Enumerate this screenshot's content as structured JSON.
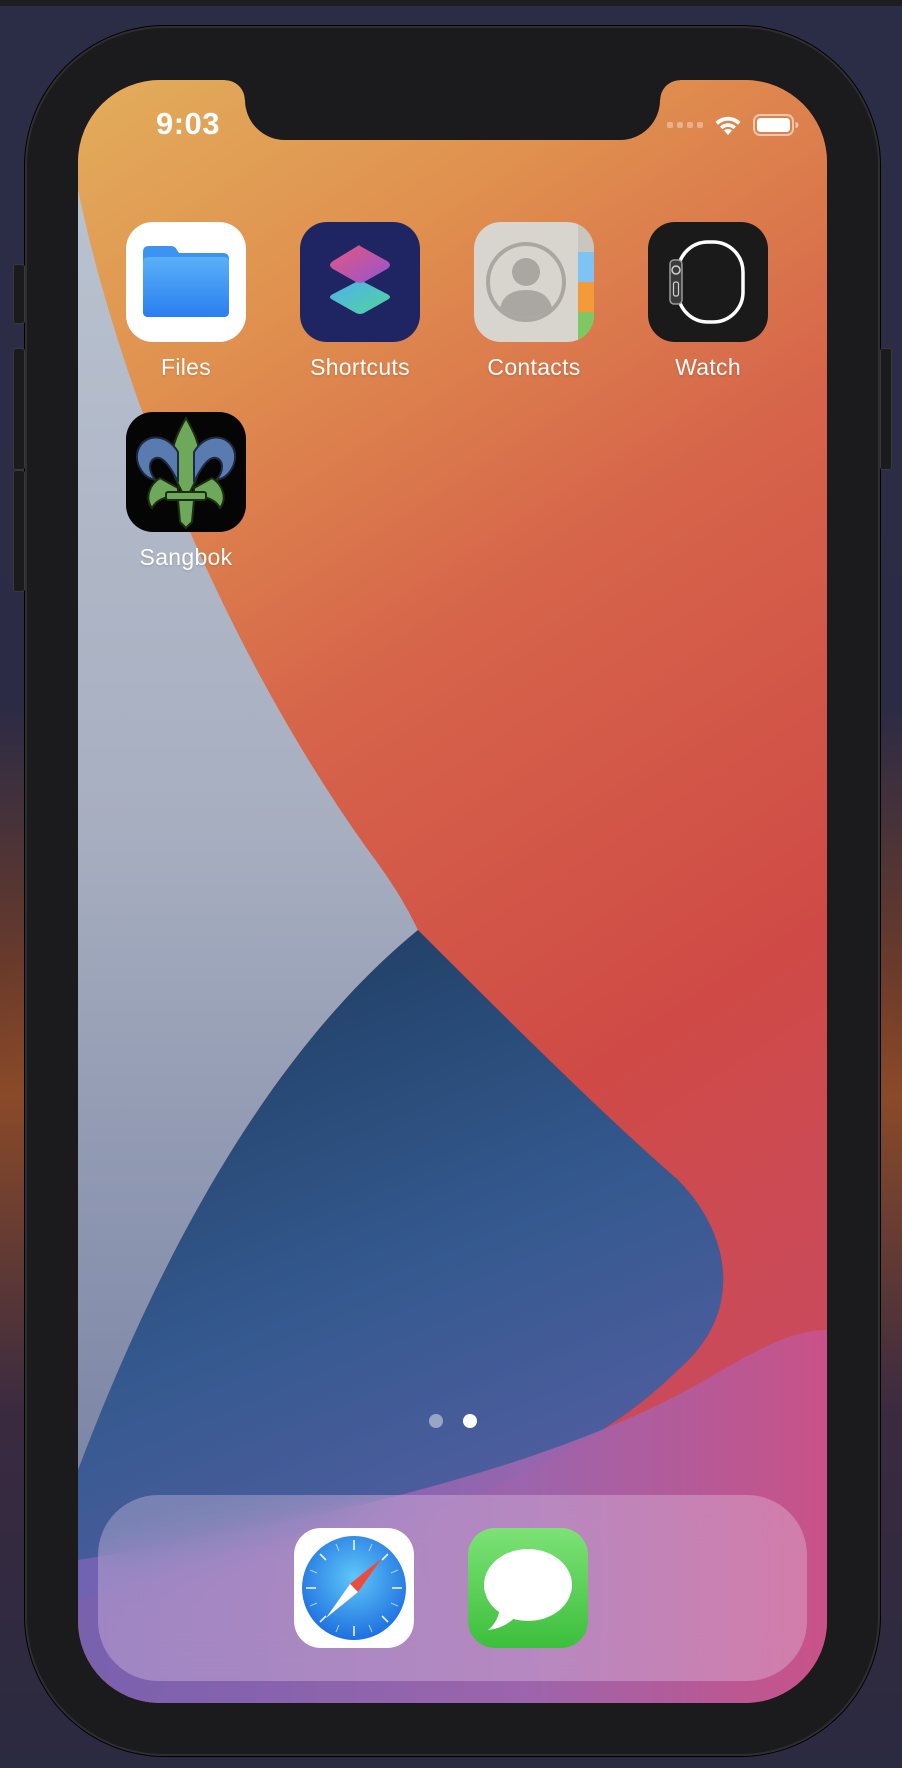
{
  "status_bar": {
    "time": "9:03",
    "icons": [
      "cellular-signal-icon",
      "wifi-icon",
      "battery-icon"
    ]
  },
  "home": {
    "apps": [
      {
        "label": "Files",
        "icon": "files-folder-icon"
      },
      {
        "label": "Shortcuts",
        "icon": "shortcuts-icon"
      },
      {
        "label": "Contacts",
        "icon": "contacts-icon"
      },
      {
        "label": "Watch",
        "icon": "watch-icon"
      },
      {
        "label": "Sangbok",
        "icon": "fleur-de-lis-icon"
      }
    ]
  },
  "page_indicator": {
    "pages": 2,
    "current_page": 2
  },
  "dock": {
    "apps": [
      {
        "icon": "safari-compass-icon"
      },
      {
        "icon": "messages-bubble-icon"
      }
    ]
  },
  "colors": {
    "wallpaper_orange": "#e0a658",
    "wallpaper_red": "#cf4a44",
    "wallpaper_blue": "#2f5a8c",
    "wallpaper_grey": "#a9b0c2",
    "device_frame": "#1b1b1d"
  }
}
